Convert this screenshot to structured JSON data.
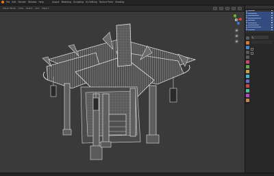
{
  "topbar": {
    "menus": [
      "File",
      "Edit",
      "Render",
      "Window",
      "Help"
    ],
    "workspace_tabs": [
      "Layout",
      "Modeling",
      "Sculpting",
      "UV Editing",
      "Texture Paint",
      "Shading"
    ]
  },
  "viewport_header": {
    "items": [
      "Object Mode",
      "View",
      "Select",
      "Add",
      "Object"
    ],
    "shading": "wireframe"
  },
  "outliner": {
    "row_count": 9,
    "selected_rows": [
      1,
      2,
      3,
      4,
      5,
      6,
      7,
      8
    ]
  },
  "properties": {
    "header_icon": "wrench-icon",
    "title": "",
    "subtitle": "",
    "section_label": "",
    "rows": [
      "",
      ""
    ]
  },
  "properties_tabs_colors": [
    "#5a5a5a",
    "#d07a3a",
    "#4b84c4",
    "#5a5a5a",
    "#5a5a5a",
    "#c44b6b",
    "#6aa84f",
    "#c4a44b",
    "#4bb0c4",
    "#6a6ac4",
    "#c44b4b",
    "#4bc4a4",
    "#b44bc4",
    "#c48a4b"
  ],
  "statusbar": {
    "items": [
      "",
      "",
      ""
    ]
  },
  "colors": {
    "viewport_bg": "#3a3a3a",
    "wire": "#d9d9d9",
    "shade": "#5e5e5e",
    "selection": "#334d80",
    "accent": "#e87d0d"
  }
}
